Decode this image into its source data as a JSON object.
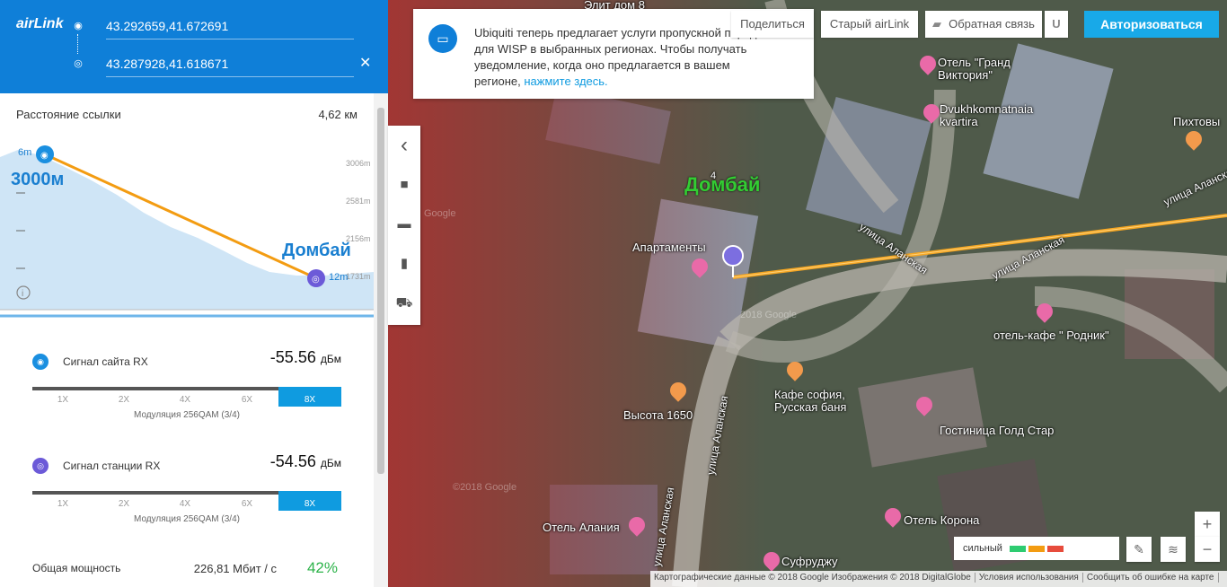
{
  "app": {
    "logo": "airLink"
  },
  "header": {
    "coord_a": "43.292659,41.672691",
    "coord_b": "43.287928,41.618671",
    "close_glyph": "✕"
  },
  "link": {
    "distance_label": "Расстояние ссылки",
    "distance_value": "4,62 км"
  },
  "profile": {
    "height_a": "6m",
    "height_b": "12m",
    "overlay_a": "3000м",
    "overlay_b": "Домбай",
    "axis": [
      "3006m",
      "2581m",
      "2156m",
      "1731m"
    ]
  },
  "signals": [
    {
      "label": "Сигнал сайта RX",
      "value": "-55.56",
      "unit": "дБм",
      "modulation": "Модуляция 256QAM (3/4)"
    },
    {
      "label": "Сигнал станции RX",
      "value": "-54.56",
      "unit": "дБм",
      "modulation": "Модуляция 256QAM (3/4)"
    }
  ],
  "scale_ticks": [
    "1X",
    "2X",
    "4X",
    "6X",
    "8X"
  ],
  "power": {
    "label": "Общая мощность",
    "value": "226,81 Мбит / с",
    "percent": "42%"
  },
  "notice": {
    "text": "Ubiquiti теперь предлагает услуги пропускной передачи для WISP в выбранных регионах. Чтобы получать уведомление, когда оно предлагается в вашем регионе,",
    "link": "нажмите здесь."
  },
  "topbar_buttons": {
    "share": "Поделиться",
    "old": "Старый airLink",
    "feedback": "Обратная связь",
    "auth": "Авторизоваться"
  },
  "map": {
    "big_label": "Домбай",
    "labels": {
      "elite": "Элит дом 8",
      "grand_1": "Отель \"Гранд",
      "grand_2": "Виктория\"",
      "dvukh_1": "Dvukhkomnatnaia",
      "dvukh_2": "kvartira",
      "pikht": "Пихтовы",
      "apart": "Апартаменты",
      "street_1": "улица Аланская",
      "street_2": "улица Аланская",
      "street_3": "улица Аланская",
      "street_4": "улица Аланская",
      "street_5": "улица Аланская",
      "rodnik": "отель-кафе \" Родник\"",
      "visota": "Высота 1650",
      "cafe_1": "Кафе софия,",
      "cafe_2": "Русская баня",
      "gold": "Гостиница Голд Стар",
      "korona": "Отель Корона",
      "alania": "Отель Алания",
      "sufr": "Суфруджу",
      "num4": "4",
      "wm1": "Google",
      "wm2": "2018 Google",
      "wm3": "©2018 Google"
    },
    "legend_label": "сильный",
    "legend_colors": [
      "#2ecc71",
      "#f39c12",
      "#e74c3c"
    ],
    "zoom_in": "+",
    "zoom_out": "−",
    "attribution": [
      "Картографические данные © 2018 Google Изображения © 2018 DigitalGlobe",
      "Условия использования",
      "Сообщить об ошибке на карте"
    ]
  },
  "icons": {
    "pin": "wifi-icon",
    "back": "‹",
    "save": "■",
    "folder": "▬",
    "doc": "▮",
    "cart": "⛟",
    "ruler": "ruler-icon",
    "layers": "layers-icon"
  }
}
